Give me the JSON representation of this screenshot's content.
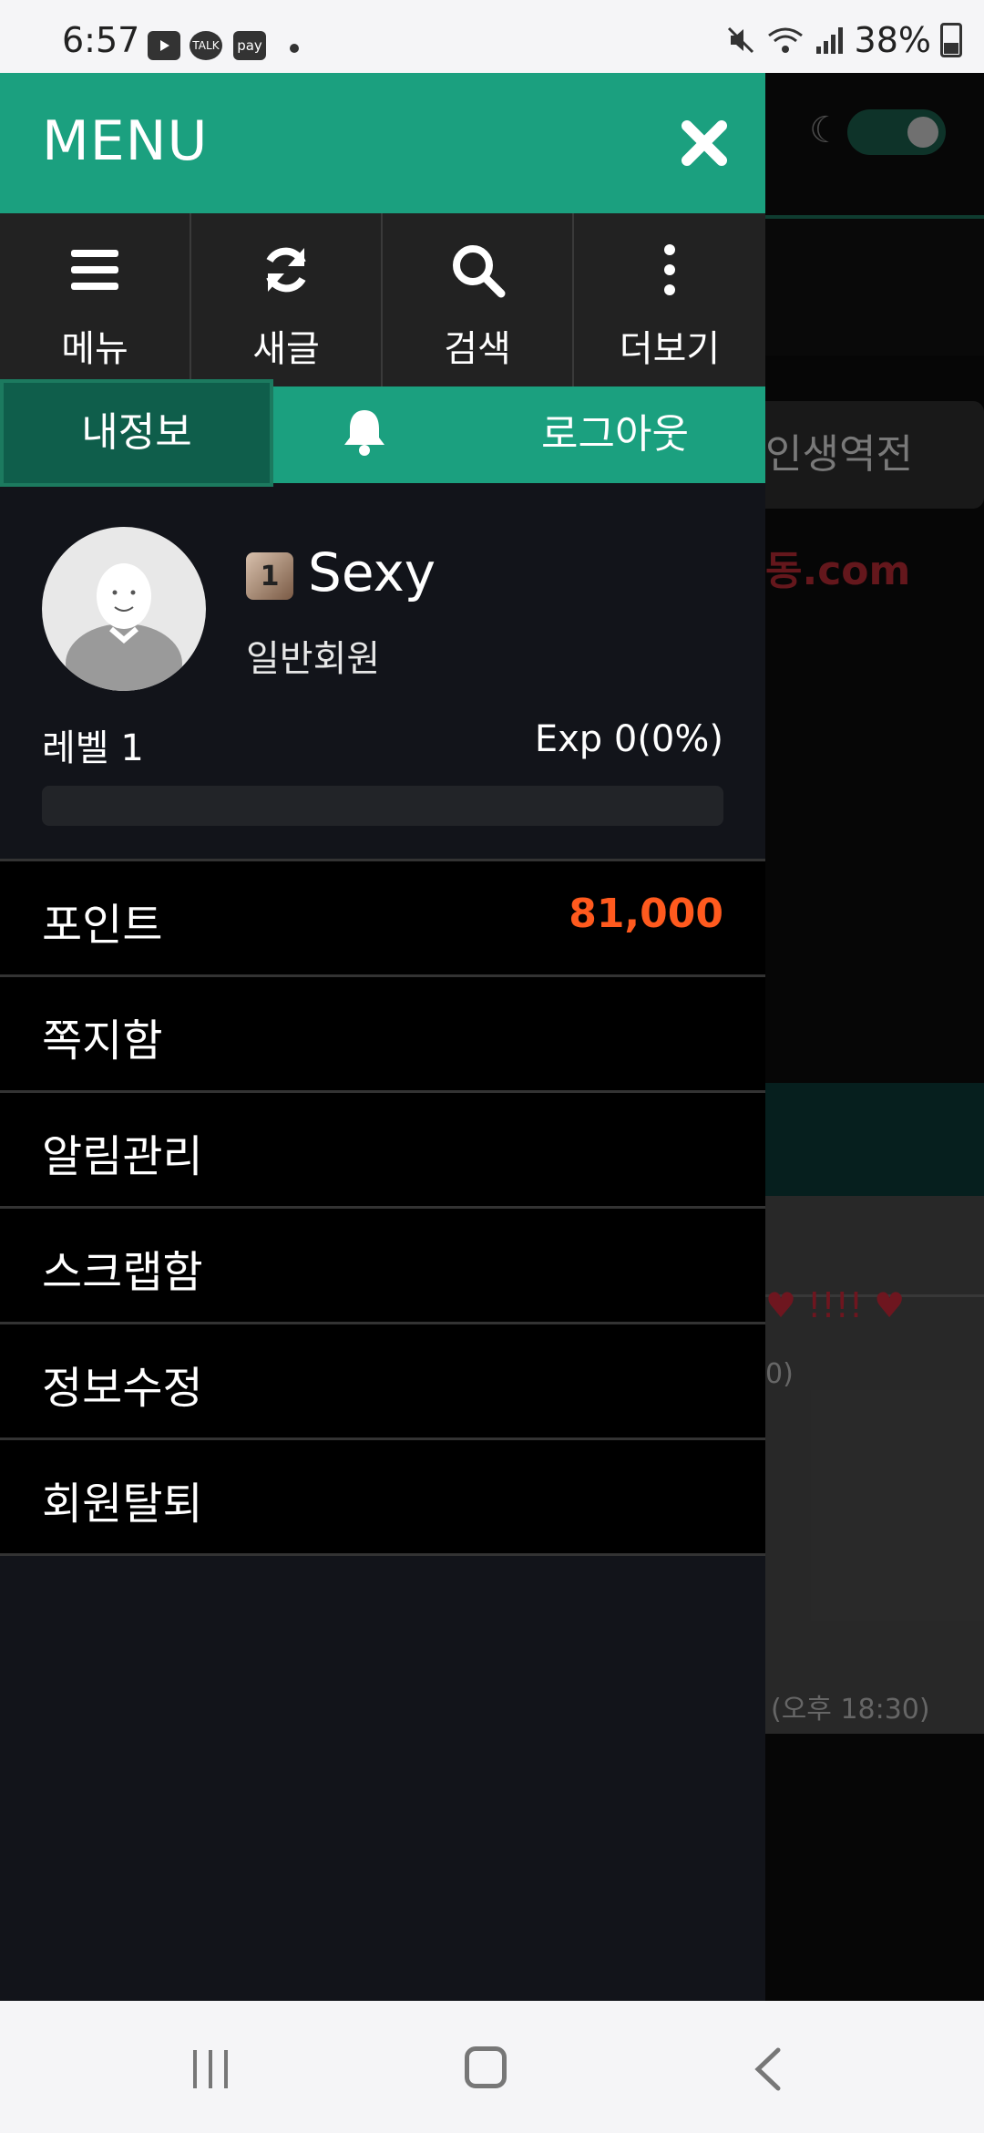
{
  "status_bar": {
    "time": "6:57",
    "notif_icons": [
      "youtube-icon",
      "kakaotalk-icon",
      "kakaopay-icon"
    ],
    "talk_label": "TALK",
    "pay_label": "pay",
    "battery": "38%"
  },
  "background": {
    "chip_text": "인생역전",
    "logo_text": "동.com",
    "hearts_text": "♥ !!!! ♥",
    "count_text": "0)",
    "date_text": "(오후 18:30)"
  },
  "drawer": {
    "title": "MENU",
    "accent_color": "#1ba07f",
    "quick_actions": [
      {
        "label": "메뉴",
        "icon": "hamburger-icon"
      },
      {
        "label": "새글",
        "icon": "refresh-icon"
      },
      {
        "label": "검색",
        "icon": "search-icon"
      },
      {
        "label": "더보기",
        "icon": "more-vertical-icon"
      }
    ],
    "tabs": {
      "my_info": "내정보",
      "logout": "로그아웃"
    },
    "profile": {
      "level_icon_text": "1",
      "name": "Sexy",
      "grade": "일반회원",
      "level": "레벨 1",
      "exp": "Exp 0(0%)",
      "exp_progress": 0
    },
    "menu": [
      {
        "label": "포인트",
        "value": "81,000"
      },
      {
        "label": "쪽지함",
        "value": ""
      },
      {
        "label": "알림관리",
        "value": ""
      },
      {
        "label": "스크랩함",
        "value": ""
      },
      {
        "label": "정보수정",
        "value": ""
      },
      {
        "label": "회원탈퇴",
        "value": ""
      }
    ],
    "point_color": "#ff5a1e"
  }
}
